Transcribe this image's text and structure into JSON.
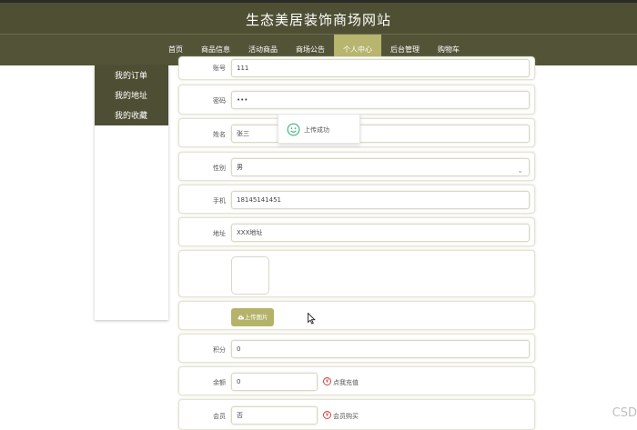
{
  "site": {
    "title": "生态美居装饰商场网站"
  },
  "nav": {
    "items": [
      {
        "label": "首页"
      },
      {
        "label": "商品信息"
      },
      {
        "label": "活动商品"
      },
      {
        "label": "商场公告"
      },
      {
        "label": "个人中心",
        "active": true
      },
      {
        "label": "后台管理"
      },
      {
        "label": "购物车"
      }
    ]
  },
  "sidebar": {
    "items": [
      {
        "label": "我的订单"
      },
      {
        "label": "我的地址"
      },
      {
        "label": "我的收藏"
      }
    ]
  },
  "form": {
    "account": {
      "label": "账号",
      "value": "111"
    },
    "password": {
      "label": "密码",
      "value": "•••"
    },
    "name": {
      "label": "姓名",
      "value": "张三"
    },
    "gender": {
      "label": "性别",
      "value": "男"
    },
    "phone": {
      "label": "手机",
      "value": "18145141451"
    },
    "address": {
      "label": "地址",
      "value": "XXX地址"
    },
    "upload": {
      "button_label": "上传图片"
    },
    "points": {
      "label": "积分",
      "value": "0"
    },
    "balance": {
      "label": "余额",
      "value": "0",
      "action": "点我充值"
    },
    "member": {
      "label": "会员",
      "value": "否",
      "action": "会员购买"
    }
  },
  "toast": {
    "message": "上传成功"
  },
  "watermark": {
    "text": "CSD"
  },
  "colors": {
    "header": "#4f4f34",
    "accent": "#b7b56e",
    "sidebar": "#4e4e34"
  }
}
